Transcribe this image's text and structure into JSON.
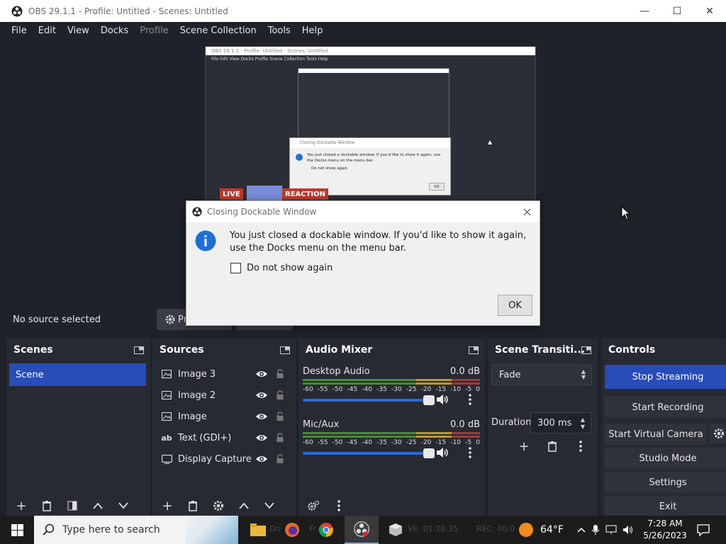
{
  "window": {
    "title": "OBS 29.1.1 - Profile: Untitled - Scenes: Untitled",
    "minimize": "—",
    "maximize": "☐",
    "close": "✕"
  },
  "menu": {
    "file": "File",
    "edit": "Edit",
    "view": "View",
    "docks": "Docks",
    "profile": "Profile",
    "scene_collection": "Scene Collection",
    "tools": "Tools",
    "help": "Help"
  },
  "preview": {
    "nested_title": "OBS 29.1.1 - Profile: Untitled - Scenes: Untitled",
    "nested_menu": "File   Edit   View   Docks   Profile   Scene Collection   Tools   Help",
    "nested_dialog_title": "Closing Dockable Window",
    "nested_dialog_text": "You just closed a dockable window. If you'd like to show it again, use the Docks menu on the menu bar.",
    "nested_dialog_check": "Do not show again",
    "nested_dialog_ok": "OK",
    "live_label": "LIVE",
    "reaction_label": "REACTION"
  },
  "source_toolbar": {
    "no_source": "No source selected",
    "properties": "Pr"
  },
  "scenes": {
    "title": "Scenes",
    "items": [
      {
        "label": "Scene"
      }
    ]
  },
  "sources": {
    "title": "Sources",
    "items": [
      {
        "label": "Image 3",
        "icon": "image-icon"
      },
      {
        "label": "Image 2",
        "icon": "image-icon"
      },
      {
        "label": "Image",
        "icon": "image-icon"
      },
      {
        "label": "Text (GDI+)",
        "icon": "text-icon"
      },
      {
        "label": "Display Capture",
        "icon": "monitor-icon"
      }
    ]
  },
  "mixer": {
    "title": "Audio Mixer",
    "channels": [
      {
        "name": "Desktop Audio",
        "db": "0.0 dB",
        "volume": 1.0
      },
      {
        "name": "Mic/Aux",
        "db": "0.0 dB",
        "volume": 1.0
      }
    ],
    "ticks": [
      "-60",
      "-55",
      "-50",
      "-45",
      "-40",
      "-35",
      "-30",
      "-25",
      "-20",
      "-15",
      "-10",
      "-5",
      "0"
    ]
  },
  "transitions": {
    "title": "Scene Transiti...",
    "selected": "Fade",
    "duration_label": "Duration",
    "duration_value": "300 ms"
  },
  "controls": {
    "title": "Controls",
    "stop_streaming": "Stop Streaming",
    "start_recording": "Start Recording",
    "start_virtual_camera": "Start Virtual Camera",
    "studio_mode": "Studio Mode",
    "settings": "Settings",
    "exit": "Exit"
  },
  "dialog": {
    "title": "Closing Dockable Window",
    "message": "You just closed a dockable window. If you'd like to show it again, use the Docks menu on the menu bar.",
    "checkbox_label": "Do not show again",
    "checkbox_checked": false,
    "ok_label": "OK"
  },
  "taskbar": {
    "search_placeholder": "Type here to search",
    "overlay_1": "Dri",
    "overlay_2": "Fr",
    "overlay_3": "VE: 01:28:35",
    "overlay_4": "REC: 00:0",
    "weather": "64°F",
    "time": "7:28 AM",
    "date": "5/26/2023"
  },
  "colors": {
    "accent": "#284cb8",
    "dock_bg": "#272a33",
    "window_bg": "#1f2229",
    "info_blue": "#1f6fd0"
  }
}
